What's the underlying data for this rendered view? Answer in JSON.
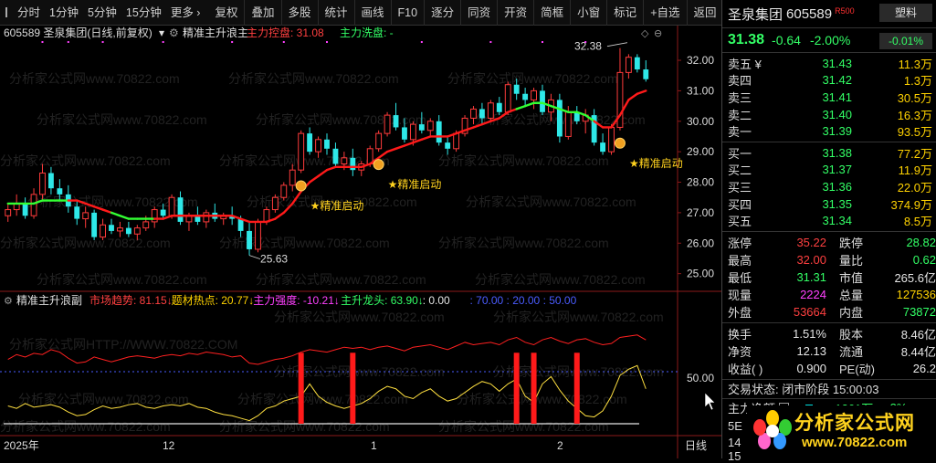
{
  "toolbar": {
    "periods": [
      "分时",
      "1分钟",
      "5分钟",
      "15分钟",
      "更多 ›"
    ],
    "tools": [
      "复权",
      "叠加",
      "多股",
      "统计",
      "画线",
      "F10",
      "逐分",
      "同资",
      "开资",
      "简框",
      "小窗",
      "标记",
      "+自选",
      "返回"
    ]
  },
  "main_chart": {
    "title": "605589 圣泉集团(日线,前复权)",
    "indicator_name": "精准主升浪主",
    "control_label": "主力控盘: 31.08",
    "wash_label": "主力洗盘: -",
    "y_ticks": [
      "32.00",
      "31.00",
      "30.00",
      "29.00",
      "28.00",
      "27.00",
      "26.00",
      "25.00"
    ],
    "high_label": "32.38",
    "low_label": "25.63",
    "signals": [
      "★精准启动",
      "★精准启动",
      "★精准启动"
    ],
    "watermark": "分析家公式网www.70822.com"
  },
  "sub_chart": {
    "name": "精准主升浪副",
    "labels": [
      {
        "text": "市场趋势: 81.15↓",
        "color": "#ff4040"
      },
      {
        "text": "题材热点: 20.77↓",
        "color": "#ffd200"
      },
      {
        "text": "主力强度: -10.21↓",
        "color": "#ff40ff"
      },
      {
        "text": "主升龙头: 63.90↓",
        "color": "#33ff66"
      },
      {
        "text": ": 0.00",
        "color": "#e6e6e6"
      },
      {
        "text": ": 70.00 : 20.00 : 50.00",
        "color": "#4a5cff"
      }
    ],
    "y_tick": "50.00",
    "watermark": "分析家公式网HTTP://WWW.70822.COM",
    "x_labels": [
      "2025年",
      "12",
      "1",
      "2",
      "日线"
    ]
  },
  "chart_data": {
    "type": "candlestick",
    "title": "605589 圣泉集团(日线,前复权)",
    "ylim": [
      24.6,
      32.6
    ],
    "candles": [
      {
        "o": 26.9,
        "h": 27.3,
        "l": 26.7,
        "c": 27.1
      },
      {
        "o": 27.1,
        "h": 27.6,
        "l": 26.9,
        "c": 27.3
      },
      {
        "o": 27.3,
        "h": 27.5,
        "l": 26.8,
        "c": 26.9
      },
      {
        "o": 26.9,
        "h": 27.8,
        "l": 26.8,
        "c": 27.6
      },
      {
        "o": 27.6,
        "h": 28.6,
        "l": 27.4,
        "c": 28.3
      },
      {
        "o": 28.3,
        "h": 28.5,
        "l": 27.6,
        "c": 27.8
      },
      {
        "o": 27.8,
        "h": 28.1,
        "l": 27.4,
        "c": 27.6
      },
      {
        "o": 27.6,
        "h": 27.9,
        "l": 27.0,
        "c": 27.2
      },
      {
        "o": 27.2,
        "h": 27.4,
        "l": 26.6,
        "c": 26.8
      },
      {
        "o": 26.8,
        "h": 27.2,
        "l": 26.5,
        "c": 27.0
      },
      {
        "o": 27.0,
        "h": 27.1,
        "l": 26.1,
        "c": 26.2
      },
      {
        "o": 26.2,
        "h": 26.8,
        "l": 26.1,
        "c": 26.6
      },
      {
        "o": 26.6,
        "h": 26.8,
        "l": 26.3,
        "c": 26.4
      },
      {
        "o": 26.4,
        "h": 26.7,
        "l": 26.2,
        "c": 26.5
      },
      {
        "o": 26.5,
        "h": 26.7,
        "l": 26.2,
        "c": 26.3
      },
      {
        "o": 26.3,
        "h": 26.6,
        "l": 26.1,
        "c": 26.5
      },
      {
        "o": 26.5,
        "h": 26.9,
        "l": 26.4,
        "c": 26.7
      },
      {
        "o": 26.7,
        "h": 27.2,
        "l": 26.5,
        "c": 27.1
      },
      {
        "o": 27.1,
        "h": 27.3,
        "l": 26.8,
        "c": 26.9
      },
      {
        "o": 26.9,
        "h": 27.6,
        "l": 26.8,
        "c": 27.5
      },
      {
        "o": 27.5,
        "h": 27.7,
        "l": 26.6,
        "c": 26.7
      },
      {
        "o": 26.7,
        "h": 27.0,
        "l": 26.4,
        "c": 26.9
      },
      {
        "o": 26.9,
        "h": 27.2,
        "l": 26.6,
        "c": 26.7
      },
      {
        "o": 26.7,
        "h": 27.1,
        "l": 26.5,
        "c": 27.0
      },
      {
        "o": 27.0,
        "h": 27.3,
        "l": 26.7,
        "c": 26.8
      },
      {
        "o": 26.8,
        "h": 27.0,
        "l": 26.6,
        "c": 26.9
      },
      {
        "o": 26.9,
        "h": 27.2,
        "l": 26.6,
        "c": 26.8
      },
      {
        "o": 26.8,
        "h": 26.9,
        "l": 26.2,
        "c": 26.4
      },
      {
        "o": 26.4,
        "h": 26.7,
        "l": 25.6,
        "c": 25.8
      },
      {
        "o": 25.8,
        "h": 26.8,
        "l": 25.7,
        "c": 26.7
      },
      {
        "o": 26.7,
        "h": 27.2,
        "l": 26.6,
        "c": 27.1
      },
      {
        "o": 27.1,
        "h": 27.6,
        "l": 27.0,
        "c": 27.5
      },
      {
        "o": 27.5,
        "h": 28.0,
        "l": 27.4,
        "c": 27.9
      },
      {
        "o": 27.9,
        "h": 28.6,
        "l": 27.7,
        "c": 28.4
      },
      {
        "o": 28.4,
        "h": 29.7,
        "l": 28.3,
        "c": 29.6
      },
      {
        "o": 29.6,
        "h": 29.8,
        "l": 28.9,
        "c": 29.0
      },
      {
        "o": 29.0,
        "h": 29.5,
        "l": 28.8,
        "c": 29.4
      },
      {
        "o": 29.4,
        "h": 29.6,
        "l": 28.9,
        "c": 29.1
      },
      {
        "o": 29.1,
        "h": 29.3,
        "l": 28.5,
        "c": 28.6
      },
      {
        "o": 28.6,
        "h": 29.0,
        "l": 28.4,
        "c": 28.8
      },
      {
        "o": 28.8,
        "h": 29.1,
        "l": 28.2,
        "c": 28.4
      },
      {
        "o": 28.4,
        "h": 28.7,
        "l": 28.2,
        "c": 28.6
      },
      {
        "o": 28.6,
        "h": 29.2,
        "l": 28.5,
        "c": 29.1
      },
      {
        "o": 29.1,
        "h": 29.7,
        "l": 29.0,
        "c": 29.6
      },
      {
        "o": 29.6,
        "h": 30.3,
        "l": 29.5,
        "c": 30.2
      },
      {
        "o": 30.2,
        "h": 30.6,
        "l": 29.7,
        "c": 29.8
      },
      {
        "o": 29.8,
        "h": 30.1,
        "l": 29.3,
        "c": 29.4
      },
      {
        "o": 29.4,
        "h": 30.0,
        "l": 29.2,
        "c": 29.9
      },
      {
        "o": 29.9,
        "h": 30.3,
        "l": 29.6,
        "c": 29.7
      },
      {
        "o": 29.7,
        "h": 30.1,
        "l": 29.5,
        "c": 30.0
      },
      {
        "o": 30.0,
        "h": 30.2,
        "l": 29.2,
        "c": 29.3
      },
      {
        "o": 29.3,
        "h": 29.5,
        "l": 28.9,
        "c": 29.1
      },
      {
        "o": 29.1,
        "h": 29.7,
        "l": 29.0,
        "c": 29.6
      },
      {
        "o": 29.6,
        "h": 30.2,
        "l": 29.5,
        "c": 30.1
      },
      {
        "o": 30.1,
        "h": 30.5,
        "l": 29.9,
        "c": 30.4
      },
      {
        "o": 30.4,
        "h": 30.6,
        "l": 29.9,
        "c": 30.1
      },
      {
        "o": 30.1,
        "h": 30.7,
        "l": 30.0,
        "c": 30.6
      },
      {
        "o": 30.6,
        "h": 30.8,
        "l": 30.2,
        "c": 30.3
      },
      {
        "o": 30.3,
        "h": 31.3,
        "l": 30.2,
        "c": 31.2
      },
      {
        "o": 31.2,
        "h": 31.4,
        "l": 30.7,
        "c": 30.9
      },
      {
        "o": 30.9,
        "h": 31.1,
        "l": 30.5,
        "c": 30.7
      },
      {
        "o": 30.7,
        "h": 31.1,
        "l": 30.4,
        "c": 31.0
      },
      {
        "o": 31.0,
        "h": 31.2,
        "l": 30.2,
        "c": 30.3
      },
      {
        "o": 30.3,
        "h": 30.9,
        "l": 30.0,
        "c": 30.7
      },
      {
        "o": 30.7,
        "h": 30.9,
        "l": 29.3,
        "c": 29.5
      },
      {
        "o": 29.5,
        "h": 30.5,
        "l": 29.4,
        "c": 30.3
      },
      {
        "o": 30.3,
        "h": 30.5,
        "l": 29.9,
        "c": 30.0
      },
      {
        "o": 30.0,
        "h": 30.4,
        "l": 29.6,
        "c": 30.2
      },
      {
        "o": 30.2,
        "h": 30.4,
        "l": 29.2,
        "c": 29.3
      },
      {
        "o": 29.3,
        "h": 29.6,
        "l": 28.9,
        "c": 29.0
      },
      {
        "o": 29.0,
        "h": 29.9,
        "l": 28.9,
        "c": 29.8
      },
      {
        "o": 29.8,
        "h": 32.4,
        "l": 29.7,
        "c": 31.6
      },
      {
        "o": 31.6,
        "h": 32.2,
        "l": 31.4,
        "c": 32.1
      },
      {
        "o": 32.1,
        "h": 32.2,
        "l": 31.6,
        "c": 31.7
      },
      {
        "o": 31.7,
        "h": 32.0,
        "l": 31.3,
        "c": 31.38
      }
    ],
    "ma_line": [
      27.3,
      27.3,
      27.3,
      27.3,
      27.4,
      27.4,
      27.4,
      27.4,
      27.4,
      27.3,
      27.2,
      27.1,
      27.0,
      26.9,
      26.8,
      26.8,
      26.8,
      26.8,
      26.8,
      26.9,
      26.9,
      26.9,
      26.9,
      26.9,
      26.9,
      26.9,
      26.9,
      26.8,
      26.7,
      26.7,
      26.7,
      26.8,
      27.0,
      27.3,
      27.7,
      28.0,
      28.2,
      28.4,
      28.5,
      28.5,
      28.5,
      28.5,
      28.6,
      28.8,
      29.0,
      29.1,
      29.2,
      29.3,
      29.4,
      29.5,
      29.5,
      29.5,
      29.6,
      29.7,
      29.8,
      29.9,
      30.0,
      30.1,
      30.3,
      30.4,
      30.5,
      30.6,
      30.6,
      30.5,
      30.4,
      30.3,
      30.3,
      30.2,
      30.0,
      29.8,
      29.8,
      30.2,
      30.7,
      30.9,
      31.0
    ],
    "green_segments": [
      [
        0,
        7
      ],
      [
        12,
        17
      ],
      [
        59,
        68
      ]
    ],
    "sub_red": [
      60,
      64,
      62,
      65,
      64,
      68,
      66,
      61,
      57,
      58,
      62,
      60,
      58,
      60,
      62,
      63,
      62,
      61,
      63,
      64,
      63,
      65,
      64,
      66,
      65,
      64,
      62,
      63,
      57,
      56,
      58,
      60,
      61,
      63,
      66,
      68,
      67,
      66,
      68,
      70,
      69,
      70,
      68,
      70,
      71,
      69,
      67,
      70,
      71,
      72,
      70,
      68,
      71,
      74,
      72,
      73,
      74,
      72,
      76,
      78,
      74,
      72,
      76,
      78,
      75,
      73,
      76,
      77,
      74,
      72,
      73,
      78,
      79,
      80,
      76
    ],
    "sub_yellow": [
      22,
      20,
      24,
      21,
      22,
      23,
      21,
      17,
      14,
      15,
      19,
      22,
      20,
      21,
      23,
      24,
      21,
      20,
      22,
      23,
      22,
      24,
      21,
      20,
      17,
      15,
      14,
      12,
      10,
      14,
      20,
      22,
      26,
      28,
      30,
      40,
      30,
      25,
      22,
      20,
      22,
      24,
      28,
      34,
      38,
      36,
      30,
      28,
      33,
      36,
      30,
      26,
      28,
      33,
      38,
      42,
      40,
      34,
      40,
      44,
      30,
      25,
      40,
      46,
      35,
      26,
      20,
      14,
      13,
      18,
      30,
      47,
      52,
      55,
      36
    ],
    "signal_bars": [
      34,
      40,
      59,
      61,
      66
    ]
  },
  "quote": {
    "name": "圣泉集团",
    "code": "605589",
    "badge": "R500",
    "tag": "塑料",
    "price": "31.38",
    "change": "-0.64",
    "change_pct": "-2.00%",
    "tag_pct": "-0.01%",
    "sells": [
      {
        "label": "卖五 ¥",
        "price": "31.43",
        "vol": "11.3万"
      },
      {
        "label": "卖四",
        "price": "31.42",
        "vol": "1.3万"
      },
      {
        "label": "卖三",
        "price": "31.41",
        "vol": "30.5万"
      },
      {
        "label": "卖二",
        "price": "31.40",
        "vol": "16.3万"
      },
      {
        "label": "卖一",
        "price": "31.39",
        "vol": "93.5万"
      }
    ],
    "buys": [
      {
        "label": "买一",
        "price": "31.38",
        "vol": "77.2万"
      },
      {
        "label": "买二",
        "price": "31.37",
        "vol": "11.9万"
      },
      {
        "label": "买三",
        "price": "31.36",
        "vol": "22.0万"
      },
      {
        "label": "买四",
        "price": "31.35",
        "vol": "374.9万"
      },
      {
        "label": "买五",
        "price": "31.34",
        "vol": "8.5万"
      }
    ],
    "stats1": [
      {
        "k": "涨停",
        "v": "35.22",
        "vc": "c-red",
        "k2": "跌停",
        "v2": "28.82",
        "v2c": "c-green"
      },
      {
        "k": "最高",
        "v": "32.00",
        "vc": "c-red",
        "k2": "量比",
        "v2": "0.62",
        "v2c": "c-green"
      },
      {
        "k": "最低",
        "v": "31.31",
        "vc": "c-green",
        "k2": "市值",
        "v2": "265.6亿",
        "v2c": "c-white"
      },
      {
        "k": "现量",
        "v": "2224",
        "vc": "c-magenta",
        "k2": "总量",
        "v2": "127536",
        "v2c": "c-yellow"
      },
      {
        "k": "外盘",
        "v": "53664",
        "vc": "c-red",
        "k2": "内盘",
        "v2": "73872",
        "v2c": "c-green"
      }
    ],
    "stats2": [
      {
        "k": "换手",
        "v": "1.51%",
        "vc": "c-white",
        "k2": "股本",
        "v2": "8.46亿",
        "v2c": "c-white"
      },
      {
        "k": "净资",
        "v": "12.13",
        "vc": "c-white",
        "k2": "流通",
        "v2": "8.44亿",
        "v2c": "c-white"
      },
      {
        "k": "收益( )",
        "v": "0.900",
        "vc": "c-white",
        "k2": "PE(动)",
        "v2": "26.2",
        "v2c": "c-white"
      }
    ],
    "trade_state": "交易状态: 闭市阶段 15:00:03",
    "money_flow_label": "主力净额",
    "money_flow_value": "-1261万",
    "money_flow_pct": "-3%",
    "tail_labels": [
      "5E",
      "14",
      "15"
    ]
  },
  "logo": {
    "title": "分析家公式网",
    "url": "www.70822.com"
  }
}
